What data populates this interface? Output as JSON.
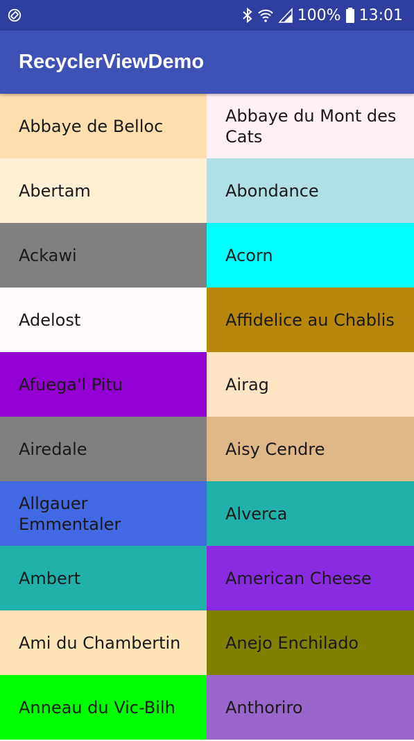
{
  "status_bar": {
    "battery": "100%",
    "time": "13:01"
  },
  "app_bar": {
    "title": "RecyclerViewDemo"
  },
  "items": [
    {
      "label": "Abbaye de Belloc",
      "color": "#ffdead"
    },
    {
      "label": "Abbaye du Mont des Cats",
      "color": "#fff0f5"
    },
    {
      "label": "Abertam",
      "color": "#ffefd5"
    },
    {
      "label": "Abondance",
      "color": "#b0e0e6"
    },
    {
      "label": "Ackawi",
      "color": "#808080"
    },
    {
      "label": "Acorn",
      "color": "#00ffff"
    },
    {
      "label": "Adelost",
      "color": "#fffafa"
    },
    {
      "label": "Affidelice au Chablis",
      "color": "#b8860b"
    },
    {
      "label": "Afuega'l Pitu",
      "color": "#9400d3"
    },
    {
      "label": "Airag",
      "color": "#ffe4c4"
    },
    {
      "label": "Airedale",
      "color": "#808080"
    },
    {
      "label": "Aisy Cendre",
      "color": "#deb887"
    },
    {
      "label": "Allgauer Emmentaler",
      "color": "#4169e1"
    },
    {
      "label": "Alverca",
      "color": "#20b2aa"
    },
    {
      "label": "Ambert",
      "color": "#20b2aa"
    },
    {
      "label": "American Cheese",
      "color": "#8a2be2"
    },
    {
      "label": "Ami du Chambertin",
      "color": "#ffe4b5"
    },
    {
      "label": "Anejo Enchilado",
      "color": "#808000"
    },
    {
      "label": "Anneau du Vic-Bilh",
      "color": "#00ff00"
    },
    {
      "label": "Anthoriro",
      "color": "#9966cc"
    }
  ]
}
